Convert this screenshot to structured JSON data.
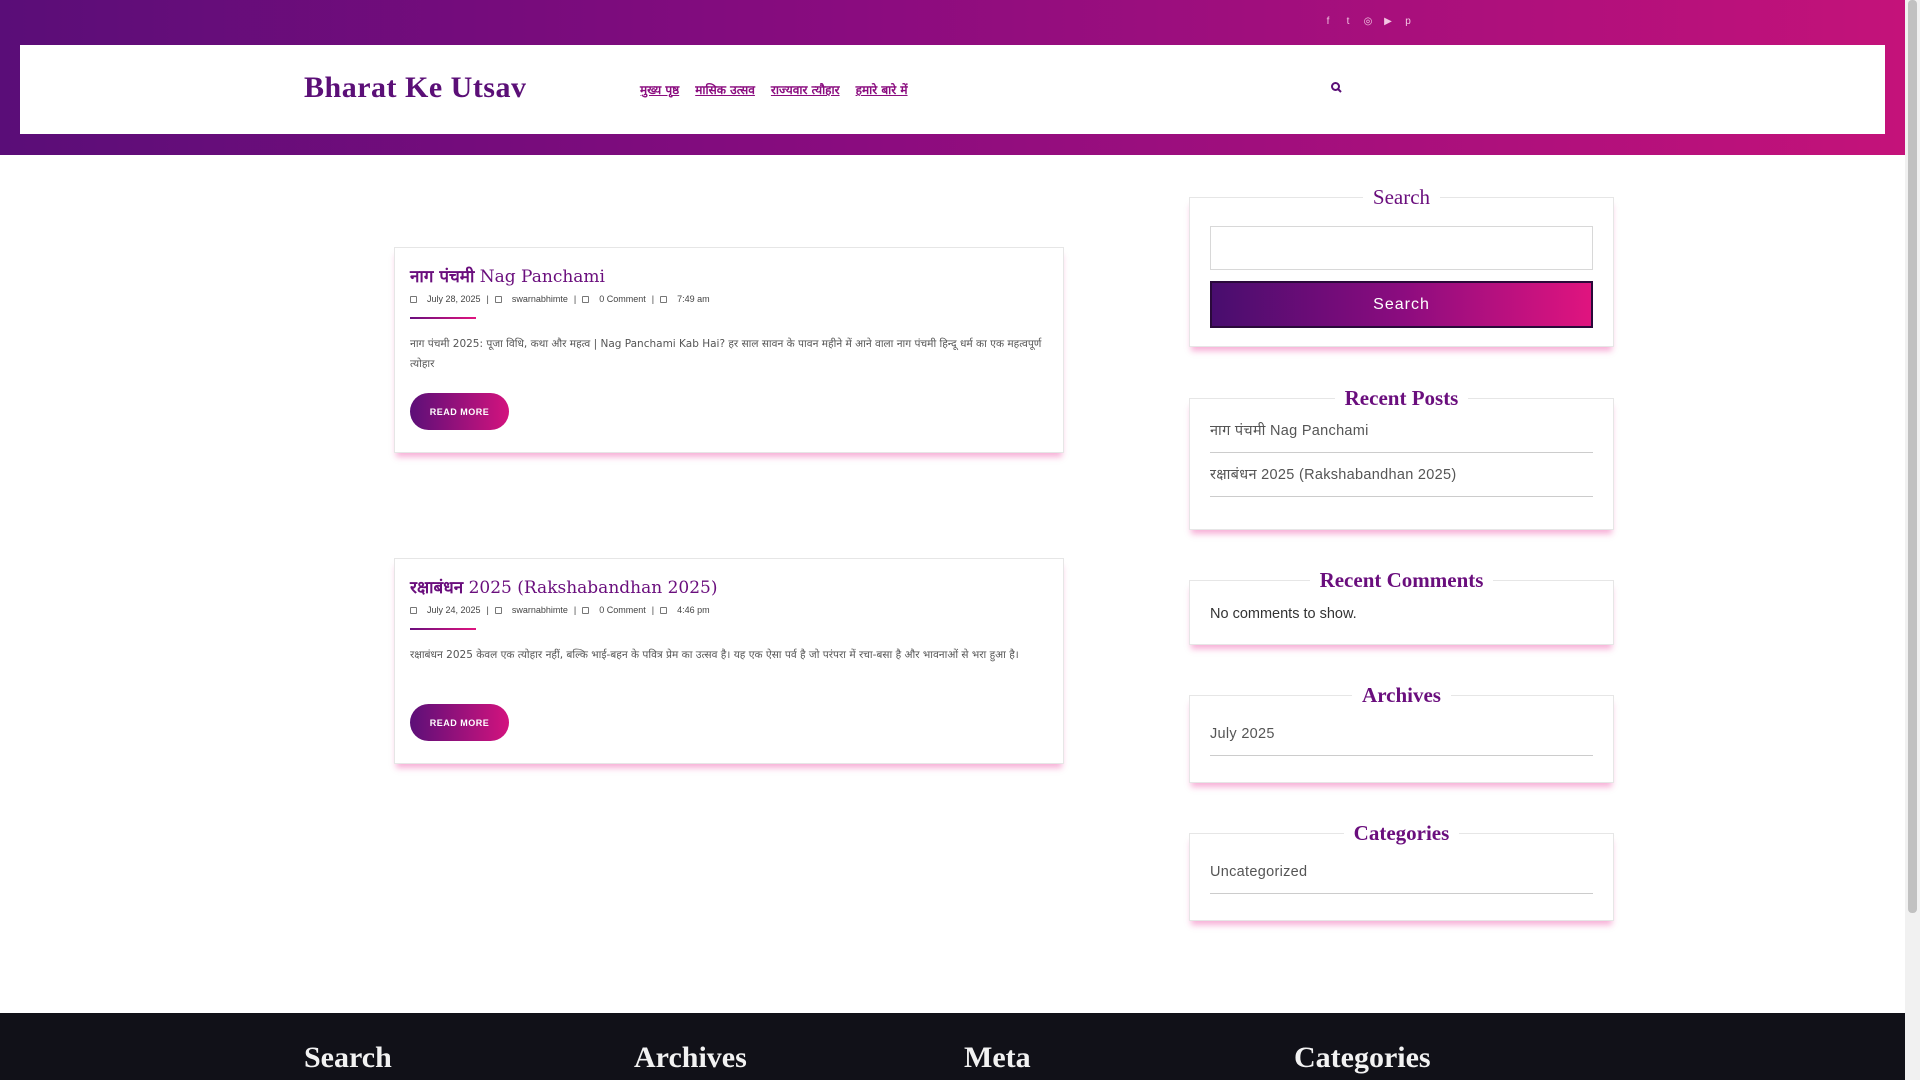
{
  "header": {
    "site_title": "Bharat Ke Utsav",
    "social_icons": [
      "facebook-icon",
      "twitter-icon",
      "instagram-icon",
      "youtube-icon",
      "pinterest-icon"
    ],
    "nav": [
      "मुख्य पृष्ठ",
      "मासिक उत्सव",
      "राज्यवार त्यौहार",
      "हमारे बारे में"
    ]
  },
  "posts": [
    {
      "title_hi": "नाग पंचमी",
      "title_en": "Nag Panchami",
      "date": "July 28, 2025",
      "author": "swarnabhimte",
      "comments": "0 Comment",
      "time": "7:49 am",
      "excerpt": "नाग पंचमी 2025: पूजा विधि, कथा और महत्व | Nag Panchami Kab Hai? हर साल सावन के पावन महीने में आने वाला नाग पंचमी हिन्दू धर्म का एक महत्वपूर्ण त्योहार",
      "read_more": "READ MORE"
    },
    {
      "title_hi": "रक्षाबंधन",
      "title_en": "2025 (Rakshabandhan 2025)",
      "date": "July 24, 2025",
      "author": "swarnabhimte",
      "comments": "0 Comment",
      "time": "4:46 pm",
      "excerpt": "रक्षाबंधन 2025 केवल एक त्योहार नहीं, बल्कि भाई-बहन के पवित्र प्रेम का उत्सव है। यह एक ऐसा पर्व है जो परंपरा में रचा-बसा है और भावनाओं से भरा हुआ है।",
      "read_more": "READ MORE"
    }
  ],
  "sidebar": {
    "search": {
      "title": "Search",
      "button": "Search",
      "value": ""
    },
    "recent_posts": {
      "title": "Recent Posts",
      "items": [
        "नाग पंचमी Nag Panchami",
        "रक्षाबंधन 2025 (Rakshabandhan 2025)"
      ]
    },
    "recent_comments": {
      "title": "Recent Comments",
      "text": "No comments to show."
    },
    "archives": {
      "title": "Archives",
      "items": [
        "July 2025"
      ]
    },
    "categories": {
      "title": "Categories",
      "items": [
        "Uncategorized"
      ]
    }
  },
  "footer": {
    "headings": [
      "Search",
      "Archives",
      "Meta",
      "Categories"
    ]
  },
  "colors": {
    "brand_purple": "#5b0f77",
    "brand_pink": "#e0147f"
  }
}
